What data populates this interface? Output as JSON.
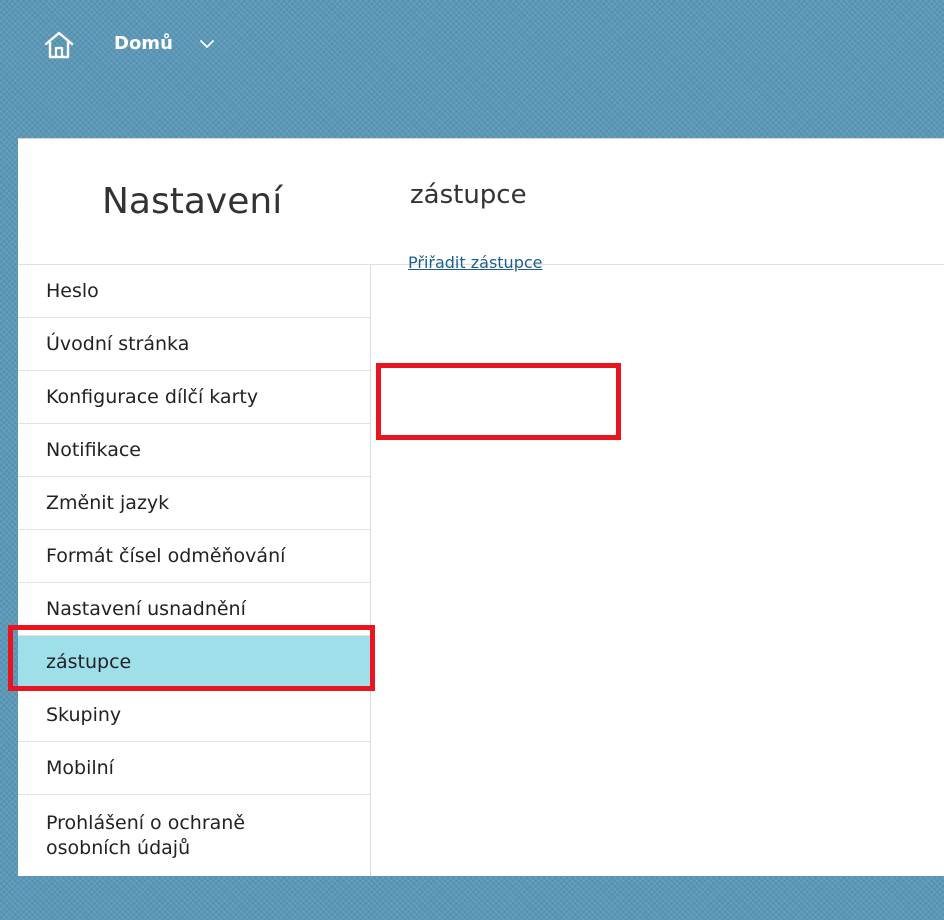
{
  "shell": {
    "home_label": "Domů",
    "home_icon": "home-icon",
    "chevron_icon": "chevron-down-icon",
    "bg_color": "#5b98b8"
  },
  "page": {
    "title": "Nastavení"
  },
  "sidebar": {
    "items": [
      {
        "label": "Heslo",
        "selected": false
      },
      {
        "label": "Úvodní stránka",
        "selected": false
      },
      {
        "label": "Konfigurace dílčí karty",
        "selected": false
      },
      {
        "label": "Notifikace",
        "selected": false
      },
      {
        "label": "Změnit jazyk",
        "selected": false
      },
      {
        "label": "Formát čísel odměňování",
        "selected": false
      },
      {
        "label": "Nastavení usnadnění",
        "selected": false
      },
      {
        "label": "zástupce",
        "selected": true
      },
      {
        "label": "Skupiny",
        "selected": false
      },
      {
        "label": "Mobilní",
        "selected": false
      },
      {
        "label": "Prohlášení o ochraně osobních údajů",
        "selected": false
      }
    ],
    "selected_color": "#9fdfea"
  },
  "content": {
    "title": "zástupce",
    "link_label": "Přiřadit zástupce"
  },
  "annotations": {
    "highlight_color": "#e8141f"
  }
}
